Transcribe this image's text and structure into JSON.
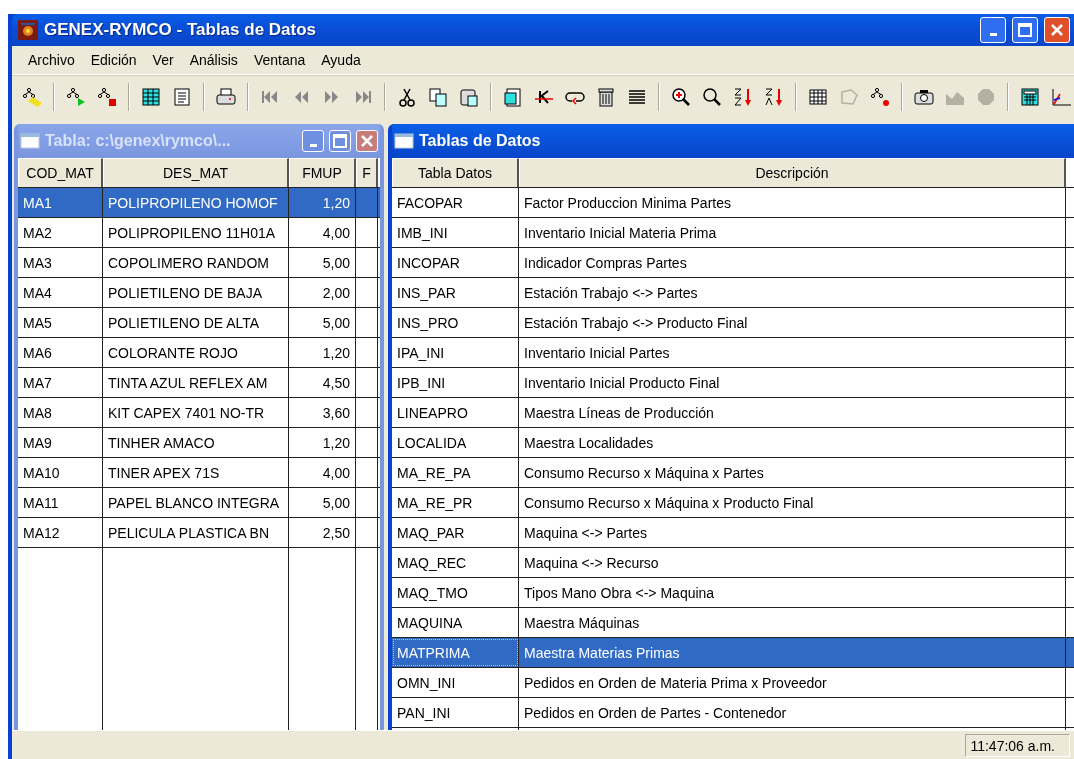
{
  "window": {
    "title": "GENEX-RYMCO - Tablas de Datos"
  },
  "menu": [
    "Archivo",
    "Edición",
    "Ver",
    "Análisis",
    "Ventana",
    "Ayuda"
  ],
  "toolbar": {
    "buttons": [
      {
        "disabled": false
      },
      {
        "disabled": false
      },
      {
        "disabled": false
      },
      {
        "disabled": false
      },
      {
        "disabled": false
      },
      {
        "disabled": false
      },
      {
        "disabled": false
      },
      {
        "disabled": false
      },
      {
        "disabled": false
      },
      {
        "disabled": false
      },
      {
        "disabled": false
      },
      {
        "disabled": false
      },
      {
        "disabled": false
      },
      {
        "disabled": false
      },
      {
        "disabled": false
      },
      {
        "disabled": false
      },
      {
        "disabled": false
      },
      {
        "disabled": false
      },
      {
        "disabled": false
      },
      {
        "disabled": false
      },
      {
        "disabled": false
      },
      {
        "disabled": false
      },
      {
        "disabled": false
      },
      {
        "disabled": true
      },
      {
        "disabled": false
      },
      {
        "disabled": false
      },
      {
        "disabled": true
      },
      {
        "disabled": true
      },
      {
        "disabled": false
      },
      {
        "disabled": false
      }
    ]
  },
  "child_windows": [
    {
      "title": "Tabla: c:\\genex\\rymco\\...",
      "active": false,
      "columns": [
        "COD_MAT",
        "DES_MAT",
        "FMUP",
        "F"
      ],
      "rows": [
        {
          "cells": [
            "MA1",
            "POLIPROPILENO HOMOF",
            "1,20"
          ],
          "selected": true
        },
        {
          "cells": [
            "MA2",
            "POLIPROPILENO 11H01A",
            "4,00"
          ],
          "selected": false
        },
        {
          "cells": [
            "MA3",
            "COPOLIMERO RANDOM",
            "5,00"
          ],
          "selected": false
        },
        {
          "cells": [
            "MA4",
            "POLIETILENO DE BAJA",
            "2,00"
          ],
          "selected": false
        },
        {
          "cells": [
            "MA5",
            "POLIETILENO DE ALTA",
            "5,00"
          ],
          "selected": false
        },
        {
          "cells": [
            "MA6",
            "COLORANTE ROJO",
            "1,20"
          ],
          "selected": false
        },
        {
          "cells": [
            "MA7",
            "TINTA AZUL REFLEX AM",
            "4,50"
          ],
          "selected": false
        },
        {
          "cells": [
            "MA8",
            "KIT CAPEX 7401 NO-TR",
            "3,60"
          ],
          "selected": false
        },
        {
          "cells": [
            "MA9",
            "TINHER AMACO",
            "1,20"
          ],
          "selected": false
        },
        {
          "cells": [
            "MA10",
            "TINER APEX 71S",
            "4,00"
          ],
          "selected": false
        },
        {
          "cells": [
            "MA11",
            "PAPEL BLANCO INTEGRA",
            "5,00"
          ],
          "selected": false
        },
        {
          "cells": [
            "MA12",
            "PELICULA PLASTICA BN",
            "2,50"
          ],
          "selected": false
        }
      ]
    },
    {
      "title": "Tablas de Datos",
      "active": true,
      "columns": [
        "Tabla Datos",
        "Descripción"
      ],
      "rows": [
        {
          "cells": [
            "FACOPAR",
            "Factor Produccion Minima Partes"
          ],
          "selected": false
        },
        {
          "cells": [
            "IMB_INI",
            "Inventario Inicial Materia Prima"
          ],
          "selected": false
        },
        {
          "cells": [
            "INCOPAR",
            "Indicador  Compras Partes"
          ],
          "selected": false
        },
        {
          "cells": [
            "INS_PAR",
            "Estación Trabajo <-> Partes"
          ],
          "selected": false
        },
        {
          "cells": [
            "INS_PRO",
            "Estación Trabajo <-> Producto Final"
          ],
          "selected": false
        },
        {
          "cells": [
            "IPA_INI",
            "Inventario Inicial Partes"
          ],
          "selected": false
        },
        {
          "cells": [
            "IPB_INI",
            "Inventario Inicial Producto Final"
          ],
          "selected": false
        },
        {
          "cells": [
            "LINEAPRO",
            "Maestra Líneas de Producción"
          ],
          "selected": false
        },
        {
          "cells": [
            "LOCALIDA",
            "Maestra Localidades"
          ],
          "selected": false
        },
        {
          "cells": [
            "MA_RE_PA",
            "Consumo Recurso x Máquina x Partes"
          ],
          "selected": false
        },
        {
          "cells": [
            "MA_RE_PR",
            "Consumo Recurso x Máquina x Producto Final"
          ],
          "selected": false
        },
        {
          "cells": [
            "MAQ_PAR",
            "Maquina <-> Partes"
          ],
          "selected": false
        },
        {
          "cells": [
            "MAQ_REC",
            "Maquina <-> Recurso"
          ],
          "selected": false
        },
        {
          "cells": [
            "MAQ_TMO",
            "Tipos Mano Obra <-> Maquina"
          ],
          "selected": false
        },
        {
          "cells": [
            "MAQUINA",
            "Maestra Máquinas"
          ],
          "selected": false
        },
        {
          "cells": [
            "MATPRIMA",
            "Maestra Materias Primas"
          ],
          "selected": true
        },
        {
          "cells": [
            "OMN_INI",
            "Pedidos en Orden de Materia Prima x Proveedor"
          ],
          "selected": false
        },
        {
          "cells": [
            "PAN_INI",
            "Pedidos en Orden de Partes - Contenedor"
          ],
          "selected": false
        }
      ]
    }
  ],
  "status_bar": {
    "time": "11:47:06 a.m."
  }
}
